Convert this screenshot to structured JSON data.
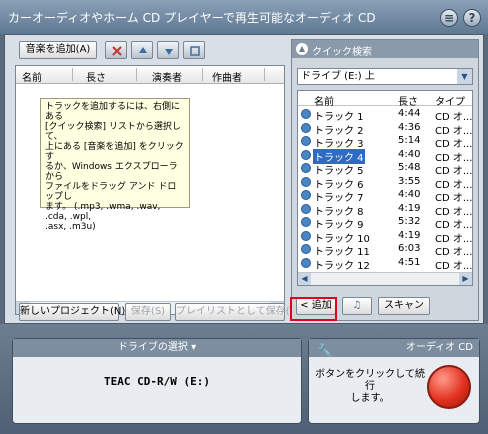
{
  "window": {
    "title": "カーオーディオやホーム CD プレイヤーで再生可能なオーディオ CD"
  },
  "toolbar": {
    "add_music_label": "音楽を追加(A)"
  },
  "list": {
    "columns": [
      "名前",
      "長さ",
      "演奏者",
      "作曲者"
    ],
    "hint": "トラックを追加するには、右側にある\n[クイック検索] リストから選択して、\n上にある [音楽を追加] をクリックす\nるか、Windows エクスプローラから\nファイルをドラッグ アンド ドロップし\nます。 (.mp3, .wma, .wav, .cda, .wpl,\n.asx, .m3u)"
  },
  "bottom_buttons": {
    "new_project": "新しいプロジェクト(N)",
    "save": "保存(S)",
    "save_as_playlist": "プレイリストとして保存(E)"
  },
  "quick_search": {
    "title": "クイック検索",
    "drive_select": "ドライブ (E:) 上",
    "columns": [
      "名前",
      "長さ",
      "タイプ"
    ],
    "tracks": [
      {
        "name": "トラック 1",
        "length": "4:44",
        "type": "CD オ..."
      },
      {
        "name": "トラック 2",
        "length": "4:36",
        "type": "CD オ..."
      },
      {
        "name": "トラック 3",
        "length": "5:14",
        "type": "CD オ..."
      },
      {
        "name": "トラック 4",
        "length": "4:40",
        "type": "CD オ..."
      },
      {
        "name": "トラック 5",
        "length": "5:48",
        "type": "CD オ..."
      },
      {
        "name": "トラック 6",
        "length": "3:55",
        "type": "CD オ..."
      },
      {
        "name": "トラック 7",
        "length": "4:40",
        "type": "CD オ..."
      },
      {
        "name": "トラック 8",
        "length": "4:19",
        "type": "CD オ..."
      },
      {
        "name": "トラック 9",
        "length": "5:32",
        "type": "CD オ..."
      },
      {
        "name": "トラック 10",
        "length": "4:19",
        "type": "CD オ..."
      },
      {
        "name": "トラック 11",
        "length": "6:03",
        "type": "CD オ..."
      },
      {
        "name": "トラック 12",
        "length": "4:51",
        "type": "CD オ..."
      }
    ],
    "selected_index": 3,
    "add_label": "< 追加",
    "scan_label": "スキャン"
  },
  "drive": {
    "title": "ドライブの選択",
    "name": "TEAC CD-R/W (E:)"
  },
  "burn": {
    "title": "オーディオ CD",
    "hint": "ボタンをクリックして続行\nします。"
  },
  "colors": {
    "highlight": "#316ac5",
    "focus_ring": "#e0001b",
    "burn_button": "#e43220"
  }
}
